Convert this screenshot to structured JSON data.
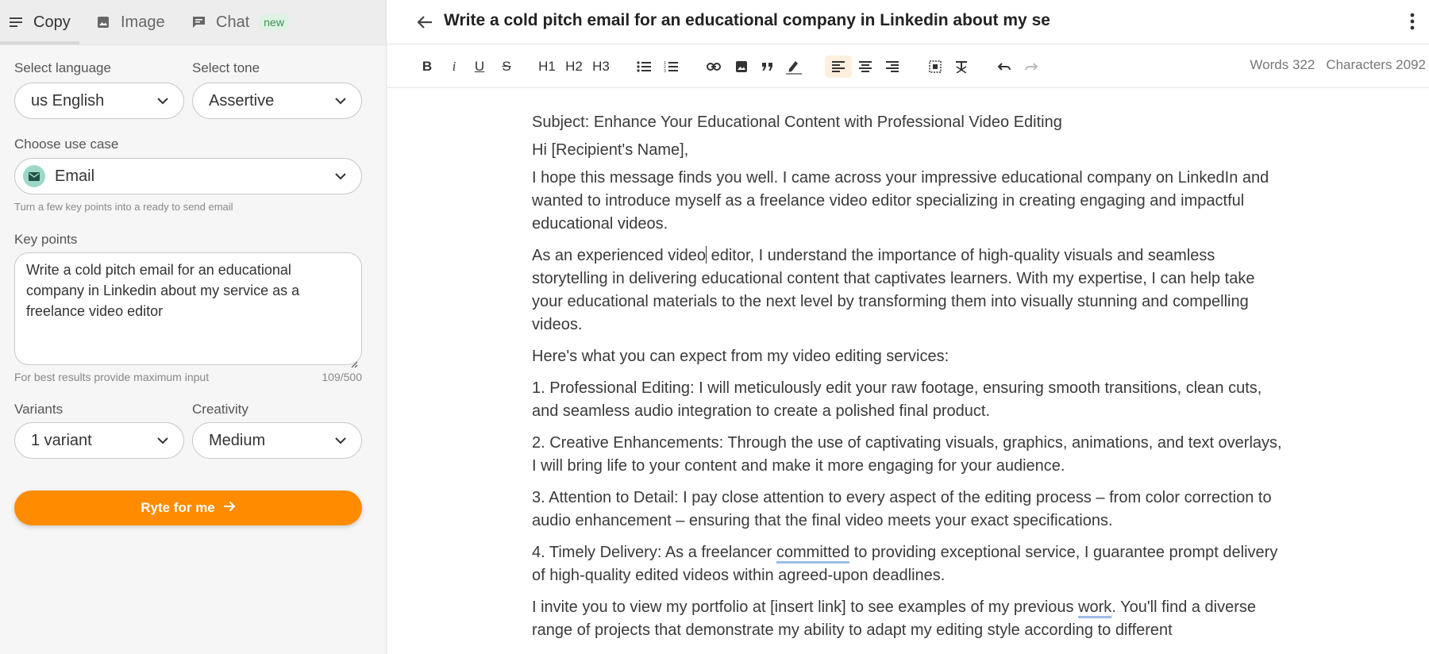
{
  "sidebar": {
    "tabs": [
      {
        "label": "Copy",
        "icon": "menu-lines-icon"
      },
      {
        "label": "Image",
        "icon": "image-icon"
      },
      {
        "label": "Chat",
        "icon": "chat-bubble-icon",
        "badge": "new"
      }
    ],
    "language": {
      "label": "Select language",
      "value": "us English"
    },
    "tone": {
      "label": "Select tone",
      "value": "Assertive"
    },
    "use_case": {
      "label": "Choose use case",
      "value": "Email",
      "hint": "Turn a few key points into a ready to send email"
    },
    "key_points": {
      "label": "Key points",
      "value": "Write a cold pitch email for an educational company in Linkedin about my service as a freelance video editor",
      "hint": "For best results provide maximum input",
      "counter": "109/500"
    },
    "variants": {
      "label": "Variants",
      "value": "1 variant"
    },
    "creativity": {
      "label": "Creativity",
      "value": "Medium"
    },
    "submit_label": "Ryte for me"
  },
  "editor": {
    "title": "Write a cold pitch email for an educational company in Linkedin about my se",
    "toolbar": {
      "h1": "H1",
      "h2": "H2",
      "h3": "H3",
      "bold": "B",
      "italic": "i",
      "underline": "U",
      "strike": "S"
    },
    "words": "Words 322",
    "characters": "Characters 2092",
    "content": {
      "subject": "Subject: Enhance Your Educational Content with Professional Video Editing",
      "greeting": "Hi [Recipient's Name],",
      "p1": "I hope this message finds you well. I came across your impressive educational company on LinkedIn and wanted to introduce myself as a freelance video editor specializing in creating engaging and impactful educational videos.",
      "p2_before": "As an experienced video",
      "p2_after": " editor, I understand the importance of high-quality visuals and seamless storytelling in delivering educational content that captivates learners. With my expertise, I can help take your educational materials to the next level by transforming them into visually stunning and compelling videos.",
      "p3": "Here's what you can expect from my video editing services:",
      "p4": "1. Professional Editing: I will meticulously edit your raw footage, ensuring smooth transitions, clean cuts, and seamless audio integration to create a polished final product.",
      "p5": "2. Creative Enhancements: Through the use of captivating visuals, graphics, animations, and text overlays, I will bring life to your content and make it more engaging for your audience.",
      "p6": "3. Attention to Detail: I pay close attention to every aspect of the editing process – from color correction to audio enhancement – ensuring that the final video meets your exact specifications.",
      "p7_before": "4. Timely Delivery: As a freelancer ",
      "p7_mark": "committed",
      "p7_after": " to providing exceptional service, I guarantee prompt delivery of high-quality edited videos within agreed-upon deadlines.",
      "p8_before": "I invite you to view my portfolio at [insert link] to see examples of my previous ",
      "p8_mark": "work",
      "p8_after": ". You'll find a diverse range of projects that demonstrate my ability to adapt my editing style according to different"
    }
  },
  "colors": {
    "accent": "#ff8c00",
    "active_tool_bg": "#fdf0de",
    "email_icon_bg": "#9dd8c8"
  }
}
